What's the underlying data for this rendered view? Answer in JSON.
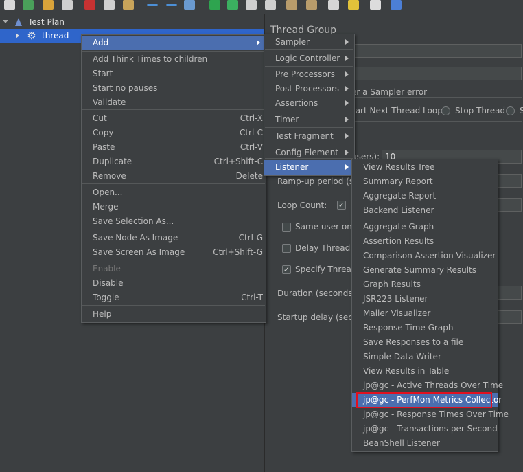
{
  "tree": {
    "root_label": "Test Plan",
    "child_label": "thread"
  },
  "right_panel": {
    "section_title": "Thread Group",
    "sampler_error_label": "er a Sampler error",
    "radio_start_next": "tart Next Thread Loop",
    "radio_stop_thread": "Stop Thread",
    "radio_trailing": "S",
    "threads_label_fragment": "users):",
    "threads_value": "10",
    "rampup_label": "Ramp-up period (sec",
    "loop_count_label": "Loop Count:",
    "same_user_label": "Same user on e",
    "delay_thread_label": "Delay Thread cr",
    "specify_thread_label": "Specify Thread",
    "duration_label": "Duration (seconds):",
    "startup_delay_label": "Startup delay (secon"
  },
  "context_menu": {
    "items": [
      {
        "label": "Add",
        "shortcut": "",
        "submenu": true,
        "highlight": true
      },
      {
        "label": "Add Think Times to children",
        "shortcut": ""
      },
      {
        "label": "Start",
        "shortcut": ""
      },
      {
        "label": "Start no pauses",
        "shortcut": ""
      },
      {
        "label": "Validate",
        "shortcut": ""
      },
      {
        "label": "Cut",
        "shortcut": "Ctrl-X"
      },
      {
        "label": "Copy",
        "shortcut": "Ctrl-C"
      },
      {
        "label": "Paste",
        "shortcut": "Ctrl-V"
      },
      {
        "label": "Duplicate",
        "shortcut": "Ctrl+Shift-C"
      },
      {
        "label": "Remove",
        "shortcut": "Delete"
      },
      {
        "label": "Open...",
        "shortcut": ""
      },
      {
        "label": "Merge",
        "shortcut": ""
      },
      {
        "label": "Save Selection As...",
        "shortcut": ""
      },
      {
        "label": "Save Node As Image",
        "shortcut": "Ctrl-G"
      },
      {
        "label": "Save Screen As Image",
        "shortcut": "Ctrl+Shift-G"
      },
      {
        "label": "Enable",
        "shortcut": "",
        "disabled": true
      },
      {
        "label": "Disable",
        "shortcut": ""
      },
      {
        "label": "Toggle",
        "shortcut": "Ctrl-T"
      },
      {
        "label": "Help",
        "shortcut": ""
      }
    ]
  },
  "add_submenu": {
    "items": [
      {
        "label": "Sampler"
      },
      {
        "label": "Logic Controller"
      },
      {
        "label": "Pre Processors"
      },
      {
        "label": "Post Processors"
      },
      {
        "label": "Assertions"
      },
      {
        "label": "Timer"
      },
      {
        "label": "Test Fragment"
      },
      {
        "label": "Config Element"
      },
      {
        "label": "Listener",
        "highlight": true
      }
    ]
  },
  "listener_submenu": {
    "items": [
      {
        "label": "View Results Tree"
      },
      {
        "label": "Summary Report"
      },
      {
        "label": "Aggregate Report"
      },
      {
        "label": "Backend Listener"
      },
      {
        "label": "Aggregate Graph"
      },
      {
        "label": "Assertion Results"
      },
      {
        "label": "Comparison Assertion Visualizer"
      },
      {
        "label": "Generate Summary Results"
      },
      {
        "label": "Graph Results"
      },
      {
        "label": "JSR223 Listener"
      },
      {
        "label": "Mailer Visualizer"
      },
      {
        "label": "Response Time Graph"
      },
      {
        "label": "Save Responses to a file"
      },
      {
        "label": "Simple Data Writer"
      },
      {
        "label": "View Results in Table"
      },
      {
        "label": "jp@gc - Active Threads Over Time"
      },
      {
        "label": "jp@gc - PerfMon Metrics Collector",
        "highlight": true
      },
      {
        "label": "jp@gc - Response Times Over Time"
      },
      {
        "label": "jp@gc - Transactions per Second"
      },
      {
        "label": "BeanShell Listener"
      }
    ]
  },
  "colors": {
    "background": "#3c3f41",
    "selection": "#2f65ca",
    "menu_highlight": "#4b6eaf",
    "annotation_red": "#e0101f"
  }
}
